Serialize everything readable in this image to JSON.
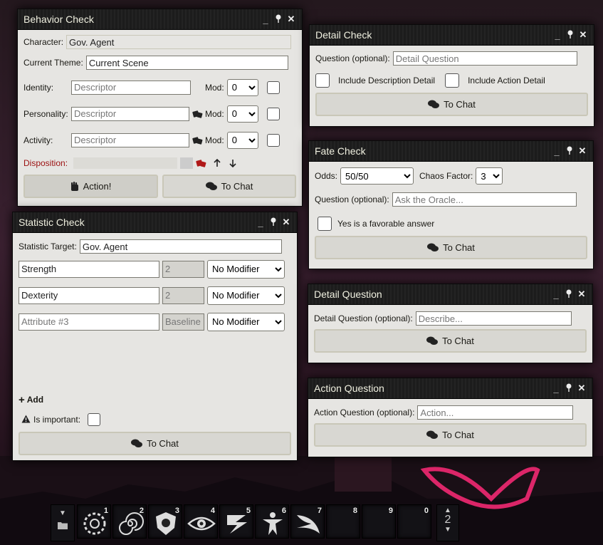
{
  "behavior_check": {
    "title": "Behavior Check",
    "character_label": "Character:",
    "character_value": "Gov. Agent",
    "theme_label": "Current Theme:",
    "theme_value": "Current Scene",
    "rows": [
      {
        "label": "Identity:",
        "placeholder": "Descriptor",
        "mod_label": "Mod:",
        "mod_value": "0"
      },
      {
        "label": "Personality:",
        "placeholder": "Descriptor",
        "mod_label": "Mod:",
        "mod_value": "0"
      },
      {
        "label": "Activity:",
        "placeholder": "Descriptor",
        "mod_label": "Mod:",
        "mod_value": "0"
      }
    ],
    "disposition_label": "Disposition:",
    "action_button": "Action!",
    "chat_button": "To Chat"
  },
  "statistic_check": {
    "title": "Statistic Check",
    "target_label": "Statistic Target:",
    "target_value": "Gov. Agent",
    "attributes": [
      {
        "name": "Strength",
        "placeholder": "",
        "value": "2",
        "value_placeholder": "",
        "modifier": "No Modifier"
      },
      {
        "name": "Dexterity",
        "placeholder": "",
        "value": "2",
        "value_placeholder": "",
        "modifier": "No Modifier"
      },
      {
        "name": "",
        "placeholder": "Attribute #3",
        "value": "",
        "value_placeholder": "Baseline",
        "modifier": "No Modifier"
      }
    ],
    "add_label": "Add",
    "important_label": "Is important:",
    "chat_button": "To Chat"
  },
  "detail_check": {
    "title": "Detail Check",
    "question_label": "Question (optional):",
    "question_placeholder": "Detail Question",
    "desc_detail_label": "Include Description Detail",
    "action_detail_label": "Include Action Detail",
    "chat_button": "To Chat"
  },
  "fate_check": {
    "title": "Fate Check",
    "odds_label": "Odds:",
    "odds_value": "50/50",
    "chaos_label": "Chaos Factor:",
    "chaos_value": "3",
    "question_label": "Question (optional):",
    "question_placeholder": "Ask the Oracle...",
    "favorable_label": "Yes is a favorable answer",
    "chat_button": "To Chat"
  },
  "detail_question": {
    "title": "Detail Question",
    "question_label": "Detail Question (optional):",
    "question_placeholder": "Describe...",
    "chat_button": "To Chat"
  },
  "action_question": {
    "title": "Action Question",
    "question_label": "Action Question (optional):",
    "question_placeholder": "Action...",
    "chat_button": "To Chat"
  },
  "hotbar": {
    "slots": [
      "1",
      "2",
      "3",
      "4",
      "5",
      "6",
      "7",
      "8",
      "9",
      "0"
    ],
    "page": "2"
  },
  "colors": {
    "window_bg": "#e6e5e2",
    "header_bg": "#1c1c1c",
    "disposition_red": "#9b1010"
  }
}
